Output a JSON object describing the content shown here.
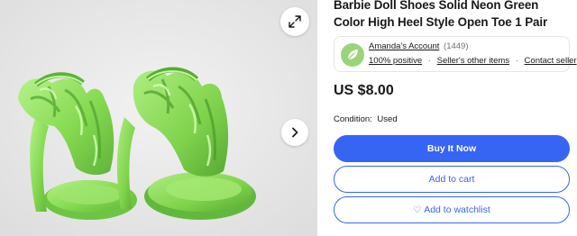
{
  "listing": {
    "title": "Barbie Doll Shoes Solid Neon Green Color High Heel Style Open Toe 1 Pair",
    "price": "US $8.00",
    "condition_label": "Condition:",
    "condition_value": "Used"
  },
  "seller": {
    "name": "Amanda's Account",
    "feedback_count": "(1449)",
    "positive": "100% positive",
    "other_items": "Seller's other items",
    "contact": "Contact seller",
    "separator": "·"
  },
  "actions": {
    "buy_now": "Buy It Now",
    "add_to_cart": "Add to cart",
    "add_to_watchlist": "Add to watchlist",
    "heart_glyph": "♡"
  },
  "icons": {
    "expand": "expand-arrows-icon",
    "next": "chevron-right-icon",
    "avatar": "seller-leaf-avatar-icon"
  },
  "colors": {
    "accent": "#3665f3",
    "shoe_green": "#8fe05a",
    "gallery_bg": "#ebebeb"
  }
}
